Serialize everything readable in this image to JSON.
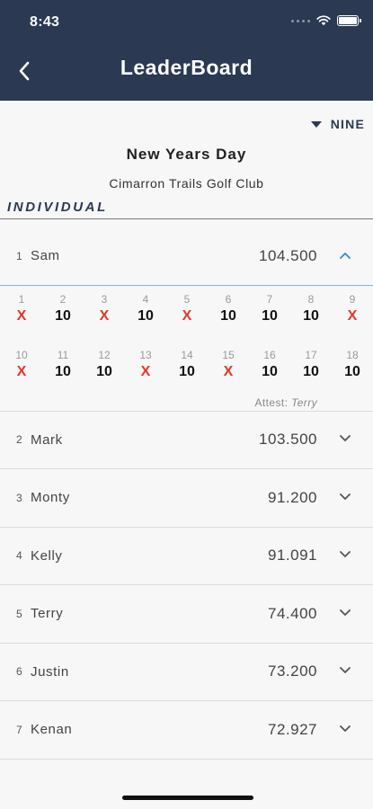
{
  "status": {
    "time": "8:43"
  },
  "header": {
    "title": "LeaderBoard"
  },
  "filter": {
    "label": "NINE"
  },
  "event": {
    "title": "New Years Day",
    "course": "Cimarron Trails Golf Club"
  },
  "section": {
    "label": "INDIVIDUAL"
  },
  "players": [
    {
      "pos": "1",
      "name": "Sam",
      "score": "104.500",
      "expanded": true
    },
    {
      "pos": "2",
      "name": "Mark",
      "score": "103.500",
      "expanded": false
    },
    {
      "pos": "3",
      "name": "Monty",
      "score": "91.200",
      "expanded": false
    },
    {
      "pos": "4",
      "name": "Kelly",
      "score": "91.091",
      "expanded": false
    },
    {
      "pos": "5",
      "name": "Terry",
      "score": "74.400",
      "expanded": false
    },
    {
      "pos": "6",
      "name": "Justin",
      "score": "73.200",
      "expanded": false
    },
    {
      "pos": "7",
      "name": "Kenan",
      "score": "72.927",
      "expanded": false
    }
  ],
  "holes": {
    "front": [
      {
        "n": "1",
        "v": "X"
      },
      {
        "n": "2",
        "v": "10"
      },
      {
        "n": "3",
        "v": "X"
      },
      {
        "n": "4",
        "v": "10"
      },
      {
        "n": "5",
        "v": "X"
      },
      {
        "n": "6",
        "v": "10"
      },
      {
        "n": "7",
        "v": "10"
      },
      {
        "n": "8",
        "v": "10"
      },
      {
        "n": "9",
        "v": "X"
      }
    ],
    "back": [
      {
        "n": "10",
        "v": "X"
      },
      {
        "n": "11",
        "v": "10"
      },
      {
        "n": "12",
        "v": "10"
      },
      {
        "n": "13",
        "v": "X"
      },
      {
        "n": "14",
        "v": "10"
      },
      {
        "n": "15",
        "v": "X"
      },
      {
        "n": "16",
        "v": "10"
      },
      {
        "n": "17",
        "v": "10"
      },
      {
        "n": "18",
        "v": "10"
      }
    ],
    "attest_label": "Attest:",
    "attest_name": "Terry"
  },
  "colors": {
    "header": "#2b3a52",
    "miss": "#e8332a",
    "accent": "#2a8fd0"
  },
  "icons": {
    "back": "chevron-left-icon",
    "expand": "chevron-down-icon",
    "collapse": "chevron-up-icon",
    "filter": "triangle-down-icon"
  }
}
